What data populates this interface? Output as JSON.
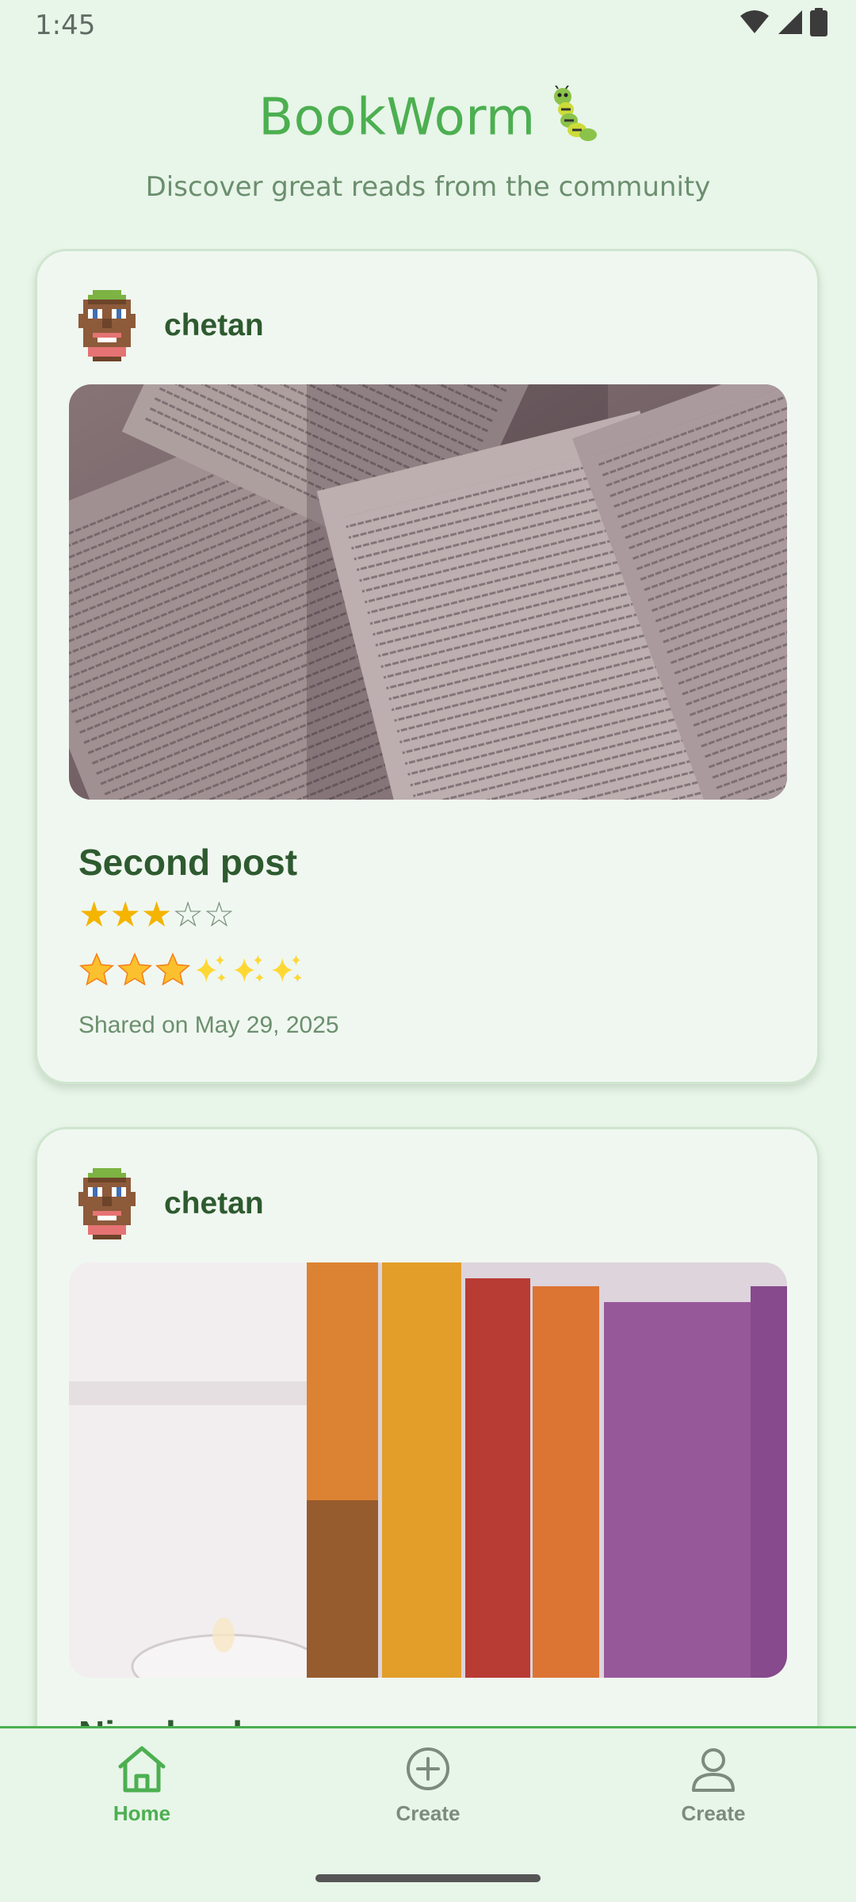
{
  "status_bar": {
    "time": "1:45"
  },
  "header": {
    "title": "BookWorm",
    "subtitle": "Discover great reads from the community"
  },
  "posts": [
    {
      "username": "chetan",
      "title": "Second post",
      "rating": 3,
      "rating_max": 5,
      "star_rating": "★★★☆☆",
      "date": "Shared on May 29, 2025"
    },
    {
      "username": "chetan",
      "title": "Nice book"
    }
  ],
  "bottom_nav": {
    "items": [
      {
        "label": "Home",
        "icon": "home-icon",
        "active": true
      },
      {
        "label": "Create",
        "icon": "add-circle-icon",
        "active": false
      },
      {
        "label": "Create",
        "icon": "person-icon",
        "active": false
      }
    ]
  },
  "colors": {
    "accent": "#4caf50",
    "background": "#e8f5e9",
    "card": "#f0f7f0",
    "text_dark": "#2e5a2f",
    "star": "#f4b400"
  }
}
